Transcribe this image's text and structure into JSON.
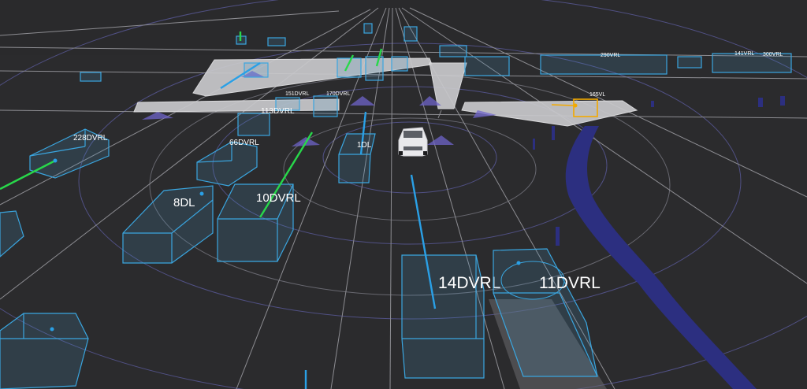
{
  "scene": {
    "colors": {
      "background": "#2b2b2d",
      "box_outline": "#3aa6e0",
      "velocity_blue": "#2aa0e6",
      "velocity_green": "#28d84a",
      "highlight_box": "#f2a900",
      "curb": "#2c2f80",
      "crosswalk": "#c9c9cc"
    },
    "ego_vehicle": {
      "icon": "white-car-icon"
    }
  },
  "objects": {
    "o14": {
      "label": "14DVRL"
    },
    "o11": {
      "label": "11DVRL"
    },
    "o10": {
      "label": "10DVRL"
    },
    "o8": {
      "label": "8DL"
    },
    "o1": {
      "label": "1DL"
    },
    "o66": {
      "label": "66DVRL"
    },
    "o228": {
      "label": "228DVRL"
    },
    "o113": {
      "label": "113DVRL"
    },
    "o151": {
      "label": "151DVRL"
    },
    "o170": {
      "label": "170DVRL"
    },
    "o165": {
      "label": "165VL"
    },
    "o290": {
      "label": "290VRL"
    },
    "o300": {
      "label": "300VRL"
    },
    "o141": {
      "label": "141VRL"
    }
  }
}
